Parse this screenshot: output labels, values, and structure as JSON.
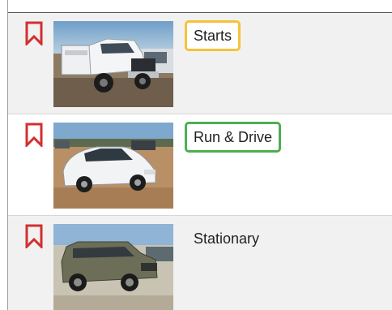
{
  "listings": [
    {
      "status_label": "Starts",
      "status_style": "yellow",
      "image_alt": "white pickup truck with utility bed"
    },
    {
      "status_label": "Run & Drive",
      "status_style": "green",
      "image_alt": "white hatchback sedan"
    },
    {
      "status_label": "Stationary",
      "status_style": "plain",
      "image_alt": "gray crossover SUV"
    }
  ],
  "colors": {
    "bookmark": "#d32f2f",
    "badge_yellow": "#f6c23a",
    "badge_green": "#4caf50",
    "row_alt_bg": "#f1f1f1"
  },
  "icons": {
    "bookmark": "bookmark-outline-icon"
  }
}
